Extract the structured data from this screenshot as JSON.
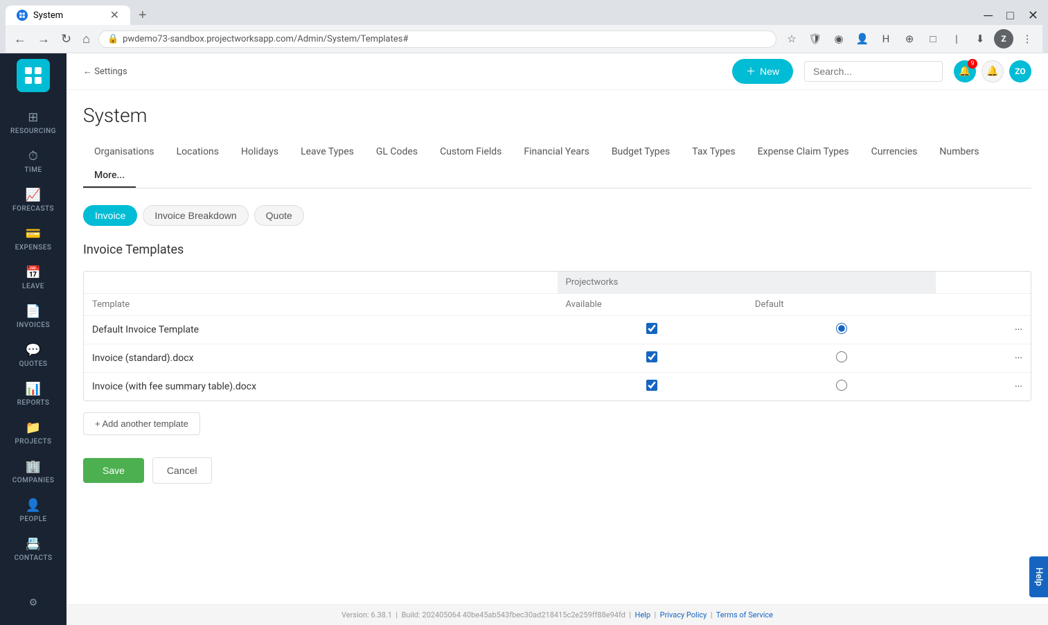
{
  "browser": {
    "tab_title": "System",
    "tab_favicon": "P",
    "url": "pwdemo73-sandbox.projectworksapp.com/Admin/System/Templates#",
    "new_tab_icon": "+",
    "win_minimize": "─",
    "win_maximize": "□",
    "win_close": "✕"
  },
  "header": {
    "back_link": "← Settings",
    "page_title": "System",
    "new_button_label": "New",
    "search_placeholder": "Search...",
    "notification_count": "9",
    "user_initials": "ZO"
  },
  "sidebar": {
    "logo_text": "≡",
    "items": [
      {
        "id": "resourcing",
        "label": "RESOURCING",
        "icon": "⊞"
      },
      {
        "id": "time",
        "label": "TIME",
        "icon": "⏱"
      },
      {
        "id": "forecasts",
        "label": "FORECASTS",
        "icon": "📈"
      },
      {
        "id": "expenses",
        "label": "EXPENSES",
        "icon": "💳"
      },
      {
        "id": "leave",
        "label": "LEAVE",
        "icon": "📅"
      },
      {
        "id": "invoices",
        "label": "INVOICES",
        "icon": "📄"
      },
      {
        "id": "quotes",
        "label": "QUOTES",
        "icon": "💬"
      },
      {
        "id": "reports",
        "label": "REPORTS",
        "icon": "📊"
      },
      {
        "id": "projects",
        "label": "PROJECTS",
        "icon": "📁"
      },
      {
        "id": "companies",
        "label": "COMPANIES",
        "icon": "🏢"
      },
      {
        "id": "people",
        "label": "PEOPLE",
        "icon": "👤"
      },
      {
        "id": "contacts",
        "label": "CONTACTS",
        "icon": "📇"
      }
    ],
    "settings_icon": "⚙"
  },
  "nav_tabs": [
    {
      "id": "organisations",
      "label": "Organisations",
      "active": false
    },
    {
      "id": "locations",
      "label": "Locations",
      "active": false
    },
    {
      "id": "holidays",
      "label": "Holidays",
      "active": false
    },
    {
      "id": "leave-types",
      "label": "Leave Types",
      "active": false
    },
    {
      "id": "gl-codes",
      "label": "GL Codes",
      "active": false
    },
    {
      "id": "custom-fields",
      "label": "Custom Fields",
      "active": false
    },
    {
      "id": "financial-years",
      "label": "Financial Years",
      "active": false
    },
    {
      "id": "budget-types",
      "label": "Budget Types",
      "active": false
    },
    {
      "id": "tax-types",
      "label": "Tax Types",
      "active": false
    },
    {
      "id": "expense-claim-types",
      "label": "Expense Claim Types",
      "active": false
    },
    {
      "id": "currencies",
      "label": "Currencies",
      "active": false
    },
    {
      "id": "numbers",
      "label": "Numbers",
      "active": false
    },
    {
      "id": "more",
      "label": "More...",
      "active": true
    }
  ],
  "template_tabs": [
    {
      "id": "invoice",
      "label": "Invoice",
      "active": true
    },
    {
      "id": "invoice-breakdown",
      "label": "Invoice Breakdown",
      "active": false
    },
    {
      "id": "quote",
      "label": "Quote",
      "active": false
    }
  ],
  "section_title": "Invoice Templates",
  "table": {
    "provider_name": "Projectworks",
    "col_template": "Template",
    "col_available": "Available",
    "col_default": "Default",
    "rows": [
      {
        "id": "default-invoice",
        "name": "Default Invoice Template",
        "available": true,
        "default": true
      },
      {
        "id": "invoice-standard",
        "name": "Invoice (standard).docx",
        "available": true,
        "default": false
      },
      {
        "id": "invoice-fee-summary",
        "name": "Invoice (with fee summary table).docx",
        "available": true,
        "default": false
      }
    ]
  },
  "add_template_btn": "+ Add another template",
  "save_btn": "Save",
  "cancel_btn": "Cancel",
  "footer": {
    "version": "Version: 6.38.1",
    "build": "Build: 202405064 40be45ab543fbec30ad218415c2e259ff88e94fd",
    "help": "Help",
    "privacy": "Privacy Policy",
    "terms": "Terms of Service"
  },
  "help_btn": "Help"
}
